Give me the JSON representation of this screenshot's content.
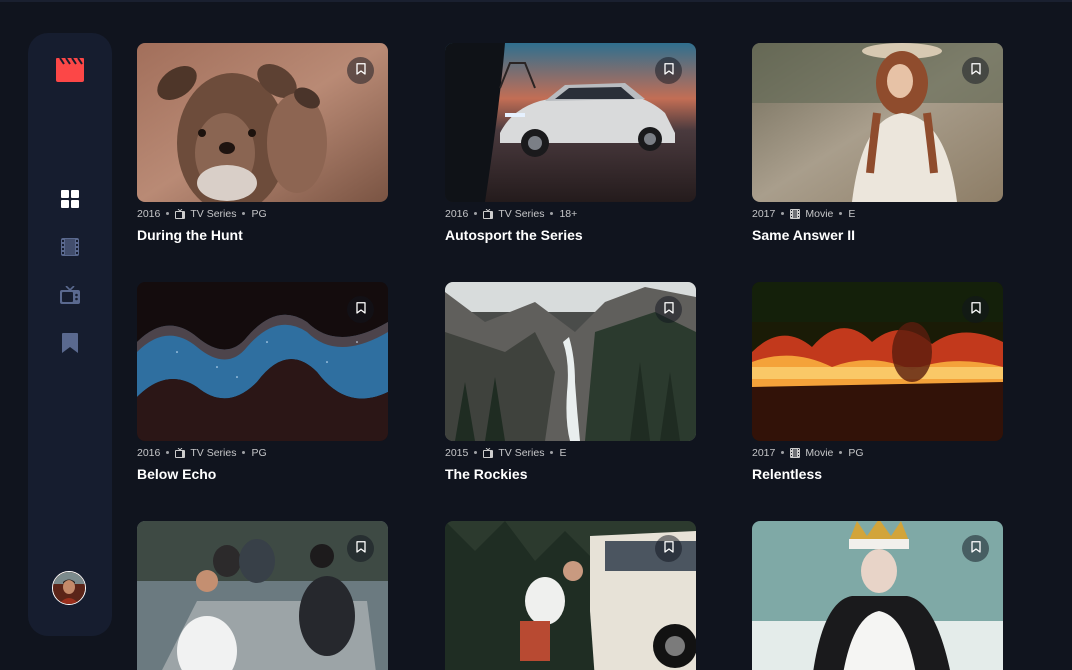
{
  "colors": {
    "background": "#10141e",
    "sidebar": "#161d2f",
    "logo_red": "#fc4747",
    "nav_active": "#ffffff",
    "nav_inactive": "#5a698f"
  },
  "sidebar": {
    "logo_icon": "film-clapper-icon",
    "items": [
      {
        "icon": "grid-icon",
        "name": "home",
        "active": true
      },
      {
        "icon": "film-icon",
        "name": "movies",
        "active": false
      },
      {
        "icon": "tv-icon",
        "name": "tv-series",
        "active": false
      },
      {
        "icon": "bookmark-icon",
        "name": "bookmarked",
        "active": false
      }
    ],
    "avatar_icon": "user-avatar"
  },
  "cards": [
    {
      "year": "2016",
      "category_icon": "tv-icon",
      "category": "TV Series",
      "rating": "PG",
      "title": "During the Hunt",
      "bookmark_icon": "bookmark-empty-icon"
    },
    {
      "year": "2016",
      "category_icon": "tv-icon",
      "category": "TV Series",
      "rating": "18+",
      "title": "Autosport the Series",
      "bookmark_icon": "bookmark-empty-icon"
    },
    {
      "year": "2017",
      "category_icon": "film-icon",
      "category": "Movie",
      "rating": "E",
      "title": "Same Answer II",
      "bookmark_icon": "bookmark-empty-icon"
    },
    {
      "year": "2016",
      "category_icon": "tv-icon",
      "category": "TV Series",
      "rating": "PG",
      "title": "Below Echo",
      "bookmark_icon": "bookmark-empty-icon"
    },
    {
      "year": "2015",
      "category_icon": "tv-icon",
      "category": "TV Series",
      "rating": "E",
      "title": "The Rockies",
      "bookmark_icon": "bookmark-empty-icon"
    },
    {
      "year": "2017",
      "category_icon": "film-icon",
      "category": "Movie",
      "rating": "PG",
      "title": "Relentless",
      "bookmark_icon": "bookmark-empty-icon"
    },
    {
      "year": "",
      "category_icon": "",
      "category": "",
      "rating": "",
      "title": "",
      "bookmark_icon": "bookmark-empty-icon"
    },
    {
      "year": "",
      "category_icon": "",
      "category": "",
      "rating": "",
      "title": "",
      "bookmark_icon": "bookmark-empty-icon"
    },
    {
      "year": "",
      "category_icon": "",
      "category": "",
      "rating": "",
      "title": "",
      "bookmark_icon": "bookmark-empty-icon"
    }
  ]
}
